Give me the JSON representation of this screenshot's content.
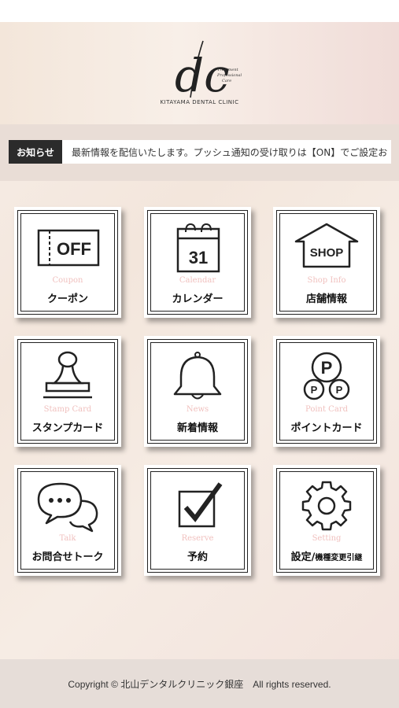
{
  "header": {
    "logo_mark": "dc",
    "logo_tagline": [
      "Treatment",
      "Professional",
      "Care"
    ],
    "clinic_name": "KITAYAMA DENTAL CLINIC"
  },
  "news": {
    "badge": "お知らせ",
    "text": "最新情報を配信いたします。プッシュ通知の受け取りは【ON】でご設定お"
  },
  "tiles": [
    {
      "en": "Coupon",
      "jp": "クーポン",
      "icon": "coupon-off-icon",
      "icon_text": "OFF"
    },
    {
      "en": "Calendar",
      "jp": "カレンダー",
      "icon": "calendar-icon",
      "icon_text": "31"
    },
    {
      "en": "Shop Info",
      "jp": "店舗情報",
      "icon": "shop-icon",
      "icon_text": "SHOP"
    },
    {
      "en": "Stamp Card",
      "jp": "スタンプカード",
      "icon": "stamp-icon"
    },
    {
      "en": "News",
      "jp": "新着情報",
      "icon": "bell-icon"
    },
    {
      "en": "Point Card",
      "jp": "ポイントカード",
      "icon": "point-coins-icon",
      "icon_text": "P"
    },
    {
      "en": "Talk",
      "jp": "お問合せトーク",
      "icon": "chat-bubbles-icon"
    },
    {
      "en": "Reserve",
      "jp": "予約",
      "icon": "checkbox-icon"
    },
    {
      "en": "Setting",
      "jp": "設定/",
      "jp_small": "機種変更引継",
      "icon": "gear-icon"
    }
  ],
  "footer": {
    "copyright": "Copyright © 北山デンタルクリニック銀座　All rights reserved."
  },
  "colors": {
    "accent_pink": "#f0c0be",
    "dark": "#2b2b2b"
  }
}
